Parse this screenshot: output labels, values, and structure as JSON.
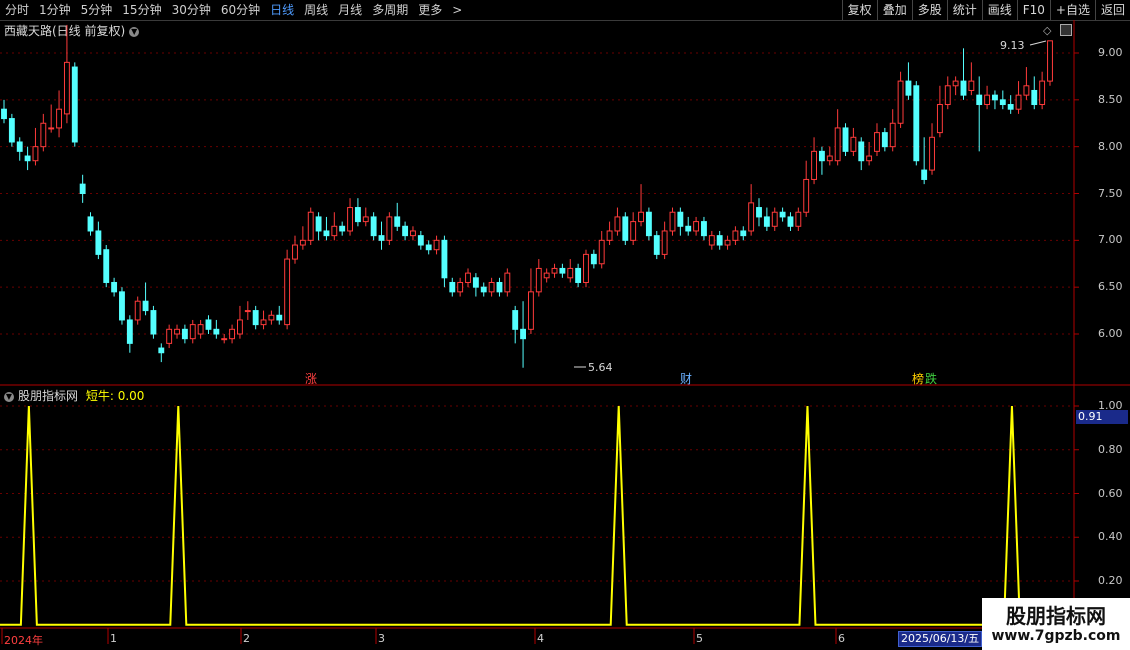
{
  "toolbar": {
    "periods": [
      "分时",
      "1分钟",
      "5分钟",
      "15分钟",
      "30分钟",
      "60分钟",
      "日线",
      "周线",
      "月线",
      "多周期",
      "更多"
    ],
    "active_period": "日线",
    "actions": [
      "复权",
      "叠加",
      "多股",
      "统计",
      "画线",
      "F10",
      "+自选",
      "返回"
    ]
  },
  "main_chart": {
    "title": "西藏天路(日线 前复权)",
    "y_ticks": [
      "9.00",
      "8.50",
      "8.00",
      "7.50",
      "7.00",
      "6.50",
      "6.00"
    ],
    "high_label": "9.13",
    "low_label": "5.64",
    "events": [
      {
        "text": "涨",
        "color": "#ff4040"
      },
      {
        "text": "财",
        "color": "#6ab0ff"
      },
      {
        "text": "榜",
        "color": "#ffd000"
      },
      {
        "text": "跌",
        "color": "#40d040"
      }
    ]
  },
  "indicator": {
    "name": "股朋指标网",
    "series_label": "短牛: 0.00",
    "y_ticks": [
      "1.00",
      "0.80",
      "0.60",
      "0.40",
      "0.20"
    ],
    "current_value": "0.91"
  },
  "time_axis": {
    "labels": [
      "2024年",
      "1",
      "2",
      "3",
      "4",
      "5",
      "6"
    ],
    "current_date": "2025/06/13/五"
  },
  "watermark": {
    "title": "股朋指标网",
    "url": "www.7gpzb.com"
  },
  "colors": {
    "up": "#ff3b3b",
    "down": "#54ffff",
    "indicator_line": "#ffff00",
    "grid": "#8a0000",
    "active_tab": "#4f9cff"
  },
  "chart_data": [
    {
      "type": "candlestick",
      "title": "西藏天路(日线 前复权)",
      "ylim": [
        5.5,
        9.3
      ],
      "annotations": [
        {
          "label": "9.13",
          "value": 9.13
        },
        {
          "label": "5.64",
          "value": 5.64
        }
      ],
      "candles": [
        [
          8.4,
          8.3,
          8.5,
          8.25
        ],
        [
          8.3,
          8.05,
          8.35,
          8.0
        ],
        [
          8.05,
          7.95,
          8.1,
          7.85
        ],
        [
          7.9,
          7.85,
          8.0,
          7.75
        ],
        [
          7.85,
          8.0,
          8.2,
          7.8
        ],
        [
          8.0,
          8.25,
          8.35,
          7.95
        ],
        [
          8.2,
          8.2,
          8.45,
          8.15
        ],
        [
          8.2,
          8.4,
          8.6,
          8.1
        ],
        [
          8.35,
          8.9,
          9.3,
          8.25
        ],
        [
          8.85,
          8.05,
          8.9,
          8.0
        ],
        [
          7.6,
          7.5,
          7.7,
          7.4
        ],
        [
          7.25,
          7.1,
          7.3,
          7.05
        ],
        [
          7.1,
          6.85,
          7.2,
          6.8
        ],
        [
          6.9,
          6.55,
          6.95,
          6.5
        ],
        [
          6.55,
          6.45,
          6.6,
          6.4
        ],
        [
          6.45,
          6.15,
          6.5,
          6.1
        ],
        [
          6.15,
          5.9,
          6.2,
          5.8
        ],
        [
          6.15,
          6.35,
          6.4,
          6.1
        ],
        [
          6.35,
          6.25,
          6.55,
          6.2
        ],
        [
          6.25,
          6.0,
          6.3,
          5.95
        ],
        [
          5.85,
          5.8,
          5.9,
          5.7
        ],
        [
          5.9,
          6.05,
          6.1,
          5.85
        ],
        [
          6.0,
          6.05,
          6.1,
          5.95
        ],
        [
          6.05,
          5.95,
          6.1,
          5.9
        ],
        [
          5.95,
          6.1,
          6.15,
          5.9
        ],
        [
          6.0,
          6.1,
          6.15,
          5.95
        ],
        [
          6.15,
          6.05,
          6.2,
          6.0
        ],
        [
          6.05,
          6.0,
          6.15,
          5.95
        ],
        [
          5.95,
          5.95,
          6.0,
          5.9
        ],
        [
          5.95,
          6.05,
          6.1,
          5.9
        ],
        [
          6.0,
          6.15,
          6.3,
          5.95
        ],
        [
          6.25,
          6.25,
          6.35,
          6.15
        ],
        [
          6.25,
          6.1,
          6.3,
          6.05
        ],
        [
          6.1,
          6.15,
          6.25,
          6.05
        ],
        [
          6.15,
          6.2,
          6.25,
          6.1
        ],
        [
          6.2,
          6.15,
          6.3,
          6.1
        ],
        [
          6.1,
          6.8,
          6.9,
          6.05
        ],
        [
          6.8,
          6.95,
          7.05,
          6.75
        ],
        [
          6.95,
          7.0,
          7.15,
          6.9
        ],
        [
          7.0,
          7.3,
          7.35,
          6.95
        ],
        [
          7.25,
          7.1,
          7.3,
          7.0
        ],
        [
          7.1,
          7.05,
          7.25,
          7.0
        ],
        [
          7.05,
          7.15,
          7.3,
          7.0
        ],
        [
          7.15,
          7.1,
          7.2,
          7.05
        ],
        [
          7.1,
          7.35,
          7.45,
          7.05
        ],
        [
          7.35,
          7.2,
          7.45,
          7.15
        ],
        [
          7.2,
          7.25,
          7.35,
          7.15
        ],
        [
          7.25,
          7.05,
          7.3,
          7.0
        ],
        [
          7.05,
          7.0,
          7.2,
          6.9
        ],
        [
          7.0,
          7.25,
          7.3,
          6.95
        ],
        [
          7.25,
          7.15,
          7.4,
          7.1
        ],
        [
          7.15,
          7.05,
          7.2,
          7.0
        ],
        [
          7.05,
          7.1,
          7.15,
          7.0
        ],
        [
          7.05,
          6.95,
          7.1,
          6.9
        ],
        [
          6.95,
          6.9,
          7.0,
          6.85
        ],
        [
          6.9,
          7.0,
          7.05,
          6.85
        ],
        [
          7.0,
          6.6,
          7.05,
          6.5
        ],
        [
          6.55,
          6.45,
          6.6,
          6.4
        ],
        [
          6.45,
          6.55,
          6.6,
          6.4
        ],
        [
          6.55,
          6.65,
          6.7,
          6.5
        ],
        [
          6.6,
          6.5,
          6.65,
          6.4
        ],
        [
          6.5,
          6.45,
          6.55,
          6.4
        ],
        [
          6.45,
          6.55,
          6.6,
          6.4
        ],
        [
          6.55,
          6.45,
          6.6,
          6.4
        ],
        [
          6.45,
          6.65,
          6.7,
          6.4
        ],
        [
          6.25,
          6.05,
          6.3,
          5.9
        ],
        [
          6.05,
          5.95,
          6.35,
          5.64
        ],
        [
          6.05,
          6.45,
          6.7,
          6.0
        ],
        [
          6.45,
          6.7,
          6.8,
          6.4
        ],
        [
          6.6,
          6.65,
          6.7,
          6.55
        ],
        [
          6.65,
          6.7,
          6.75,
          6.6
        ],
        [
          6.7,
          6.65,
          6.75,
          6.6
        ],
        [
          6.6,
          6.7,
          6.8,
          6.55
        ],
        [
          6.7,
          6.55,
          6.75,
          6.5
        ],
        [
          6.55,
          6.85,
          6.9,
          6.5
        ],
        [
          6.85,
          6.75,
          6.9,
          6.7
        ],
        [
          6.75,
          7.0,
          7.1,
          6.7
        ],
        [
          7.0,
          7.1,
          7.2,
          6.95
        ],
        [
          7.1,
          7.25,
          7.35,
          7.05
        ],
        [
          7.25,
          7.0,
          7.3,
          6.95
        ],
        [
          7.0,
          7.2,
          7.3,
          6.95
        ],
        [
          7.2,
          7.3,
          7.6,
          7.15
        ],
        [
          7.3,
          7.05,
          7.35,
          7.0
        ],
        [
          7.05,
          6.85,
          7.1,
          6.8
        ],
        [
          6.85,
          7.1,
          7.2,
          6.8
        ],
        [
          7.1,
          7.3,
          7.35,
          7.05
        ],
        [
          7.3,
          7.15,
          7.35,
          7.05
        ],
        [
          7.15,
          7.1,
          7.25,
          7.05
        ],
        [
          7.1,
          7.2,
          7.25,
          7.05
        ],
        [
          7.2,
          7.05,
          7.25,
          7.0
        ],
        [
          6.95,
          7.05,
          7.1,
          6.9
        ],
        [
          7.05,
          6.95,
          7.1,
          6.9
        ],
        [
          6.95,
          7.0,
          7.05,
          6.9
        ],
        [
          7.0,
          7.1,
          7.15,
          6.95
        ],
        [
          7.1,
          7.05,
          7.15,
          7.0
        ],
        [
          7.1,
          7.4,
          7.6,
          7.05
        ],
        [
          7.35,
          7.25,
          7.45,
          7.15
        ],
        [
          7.25,
          7.15,
          7.35,
          7.1
        ],
        [
          7.15,
          7.3,
          7.35,
          7.1
        ],
        [
          7.3,
          7.25,
          7.35,
          7.2
        ],
        [
          7.25,
          7.15,
          7.3,
          7.1
        ],
        [
          7.15,
          7.3,
          7.35,
          7.1
        ],
        [
          7.3,
          7.65,
          7.85,
          7.25
        ],
        [
          7.65,
          7.95,
          8.1,
          7.6
        ],
        [
          7.95,
          7.85,
          8.0,
          7.7
        ],
        [
          7.85,
          7.9,
          8.0,
          7.8
        ],
        [
          7.85,
          8.2,
          8.4,
          7.8
        ],
        [
          8.2,
          7.95,
          8.25,
          7.9
        ],
        [
          7.95,
          8.1,
          8.2,
          7.9
        ],
        [
          8.05,
          7.85,
          8.1,
          7.75
        ],
        [
          7.85,
          7.9,
          8.05,
          7.8
        ],
        [
          7.95,
          8.15,
          8.25,
          7.9
        ],
        [
          8.15,
          8.0,
          8.2,
          7.95
        ],
        [
          8.0,
          8.25,
          8.4,
          7.95
        ],
        [
          8.25,
          8.7,
          8.8,
          8.2
        ],
        [
          8.7,
          8.55,
          8.9,
          8.5
        ],
        [
          8.65,
          7.85,
          8.7,
          7.8
        ],
        [
          7.75,
          7.65,
          8.1,
          7.6
        ],
        [
          7.75,
          8.1,
          8.25,
          7.7
        ],
        [
          8.15,
          8.45,
          8.65,
          8.1
        ],
        [
          8.45,
          8.65,
          8.75,
          8.4
        ],
        [
          8.65,
          8.7,
          8.75,
          8.55
        ],
        [
          8.7,
          8.55,
          9.05,
          8.5
        ],
        [
          8.6,
          8.7,
          8.9,
          8.55
        ],
        [
          8.55,
          8.45,
          8.75,
          7.95
        ],
        [
          8.45,
          8.55,
          8.65,
          8.4
        ],
        [
          8.55,
          8.5,
          8.6,
          8.4
        ],
        [
          8.5,
          8.45,
          8.6,
          8.4
        ],
        [
          8.45,
          8.4,
          8.55,
          8.35
        ],
        [
          8.4,
          8.55,
          8.7,
          8.35
        ],
        [
          8.55,
          8.65,
          8.85,
          8.5
        ],
        [
          8.6,
          8.45,
          8.75,
          8.4
        ],
        [
          8.45,
          8.7,
          8.8,
          8.4
        ],
        [
          8.7,
          9.13,
          9.13,
          8.65
        ]
      ]
    },
    {
      "type": "line",
      "title": "股朋指标网",
      "series": [
        {
          "name": "短牛",
          "values": []
        }
      ],
      "ylim": [
        0,
        1.0
      ],
      "spikes_at_candle_index": [
        1,
        20,
        76,
        100,
        126
      ],
      "spike_value": 1.0,
      "baseline": 0.0
    }
  ]
}
